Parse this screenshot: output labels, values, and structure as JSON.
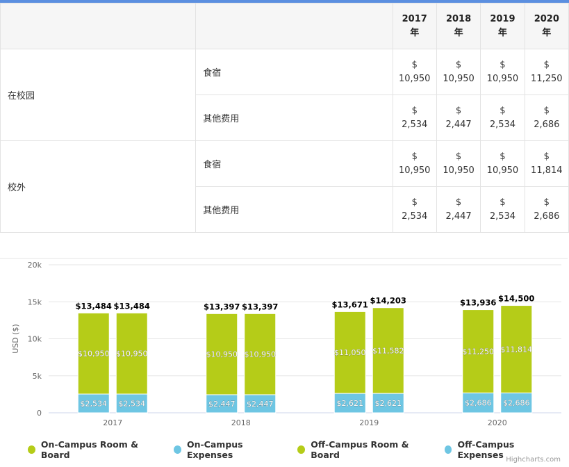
{
  "table": {
    "years": [
      {
        "year": "2017",
        "unit": "年"
      },
      {
        "year": "2018",
        "unit": "年"
      },
      {
        "year": "2019",
        "unit": "年"
      },
      {
        "year": "2020",
        "unit": "年"
      }
    ],
    "sections": [
      {
        "location": "在校园",
        "rows": [
          {
            "type": "食宿",
            "values": [
              "10,950",
              "10,950",
              "10,950",
              "11,250"
            ]
          },
          {
            "type": "其他费用",
            "values": [
              "2,534",
              "2,447",
              "2,534",
              "2,686"
            ]
          }
        ]
      },
      {
        "location": "校外",
        "rows": [
          {
            "type": "食宿",
            "values": [
              "10,950",
              "10,950",
              "10,950",
              "11,814"
            ]
          },
          {
            "type": "其他费用",
            "values": [
              "2,534",
              "2,447",
              "2,534",
              "2,686"
            ]
          }
        ]
      }
    ],
    "currency": "$"
  },
  "chart_data": {
    "type": "bar",
    "stacked": true,
    "ylabel": "USD ($)",
    "ylim": [
      0,
      20000
    ],
    "yticks": [
      {
        "value": 0,
        "label": "0"
      },
      {
        "value": 5000,
        "label": "5k"
      },
      {
        "value": 10000,
        "label": "10k"
      },
      {
        "value": 15000,
        "label": "15k"
      },
      {
        "value": 20000,
        "label": "20k"
      }
    ],
    "categories": [
      "2017",
      "2018",
      "2019",
      "2020"
    ],
    "stacks": [
      {
        "name": "on-campus",
        "series": [
          "On-Campus Expenses",
          "On-Campus Room & Board"
        ]
      },
      {
        "name": "off-campus",
        "series": [
          "Off-Campus Expenses",
          "Off-Campus Room & Board"
        ]
      }
    ],
    "series": [
      {
        "name": "On-Campus Room & Board",
        "color": "#b5cc18",
        "values": [
          10950,
          10950,
          11050,
          11250
        ],
        "labels": [
          "$10,950",
          "$10,950",
          "$11,050",
          "$11,250"
        ]
      },
      {
        "name": "On-Campus Expenses",
        "color": "#6ec6e3",
        "values": [
          2534,
          2447,
          2621,
          2686
        ],
        "labels": [
          "$2,534",
          "$2,447",
          "$2,621",
          "$2,686"
        ]
      },
      {
        "name": "Off-Campus Room & Board",
        "color": "#b5cc18",
        "values": [
          10950,
          10950,
          11582,
          11814
        ],
        "labels": [
          "$10,950",
          "$10,950",
          "$11,582",
          "$11,814"
        ]
      },
      {
        "name": "Off-Campus Expenses",
        "color": "#6ec6e3",
        "values": [
          2534,
          2447,
          2621,
          2686
        ],
        "labels": [
          "$2,534",
          "$2,447",
          "$2,621",
          "$2,686"
        ]
      }
    ],
    "totals": {
      "on-campus": [
        "$13,484",
        "$13,397",
        "$13,671",
        "$13,936"
      ],
      "off-campus": [
        "$13,484",
        "$13,397",
        "$14,203",
        "$14,500"
      ]
    },
    "legend": [
      "On-Campus Room & Board",
      "On-Campus Expenses",
      "Off-Campus Room & Board",
      "Off-Campus Expenses"
    ],
    "legend_position": "bottom",
    "grid": true
  },
  "credit": "Highcharts.com"
}
